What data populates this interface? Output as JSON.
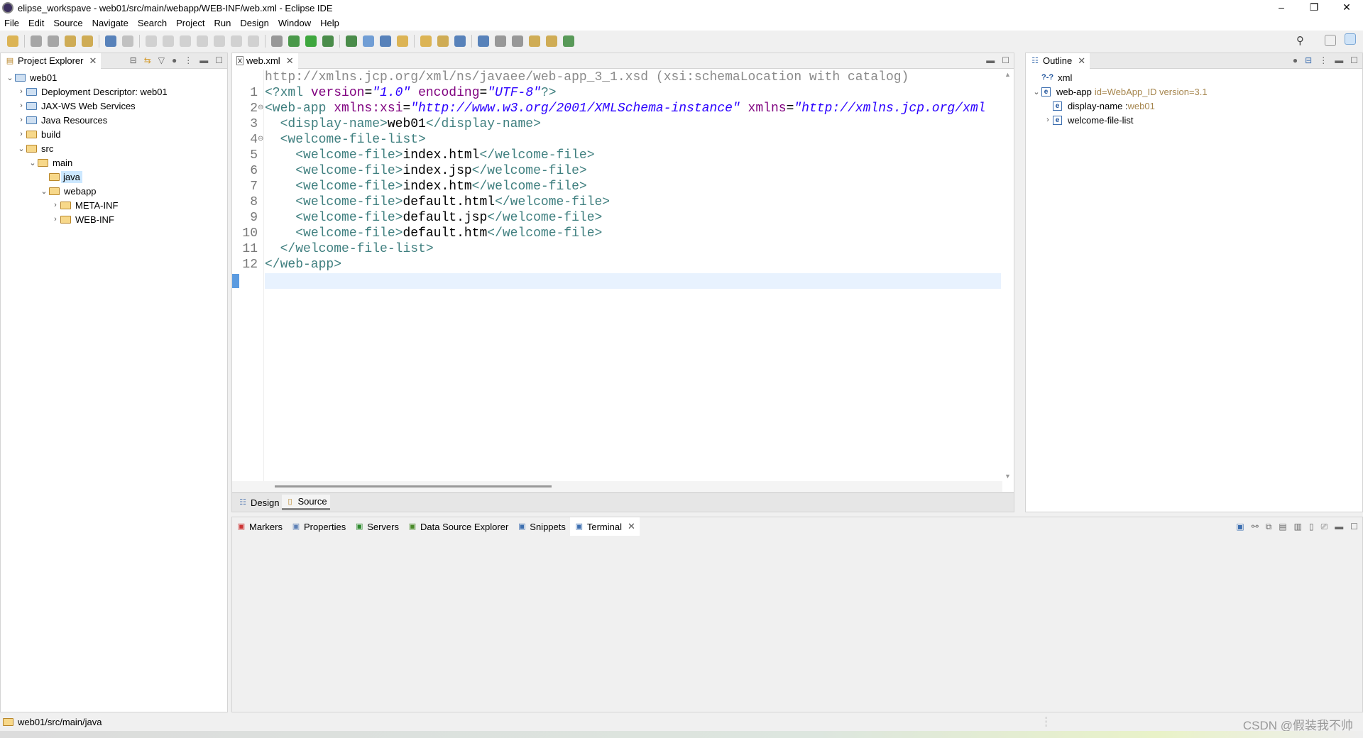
{
  "window": {
    "title": "elipse_workspave - web01/src/main/webapp/WEB-INF/web.xml - Eclipse IDE",
    "controls": [
      "–",
      "❐",
      "✕"
    ]
  },
  "menu": [
    "File",
    "Edit",
    "Source",
    "Navigate",
    "Search",
    "Project",
    "Run",
    "Design",
    "Window",
    "Help"
  ],
  "toolbar_icons": [
    "new-icon",
    "save-icon",
    "save-all-icon",
    "open-type-icon",
    "open-resource-icon",
    "terminal-icon",
    "skip-breakpoints-icon",
    "resume-icon",
    "suspend-icon",
    "terminate-icon",
    "disconnect-icon",
    "step-into-icon",
    "step-over-icon",
    "step-return-icon",
    "use-step-filters-icon",
    "debug-icon",
    "run-icon",
    "coverage-icon",
    "external-tools-icon",
    "new-server-icon",
    "new-class-icon",
    "open-folder-icon",
    "open-task-icon",
    "search-web-icon",
    "globe-icon",
    "publish-icon",
    "next-annotation-icon",
    "prev-annotation-icon",
    "back-icon",
    "forward-icon",
    "pin-icon"
  ],
  "project_explorer": {
    "title": "Project Explorer",
    "tree": [
      {
        "label": "web01",
        "level": 0,
        "expanded": true,
        "icon": "project-icon"
      },
      {
        "label": "Deployment Descriptor: web01",
        "level": 1,
        "expanded": false,
        "icon": "descriptor-icon"
      },
      {
        "label": "JAX-WS Web Services",
        "level": 1,
        "expanded": false,
        "icon": "webservices-icon"
      },
      {
        "label": "Java Resources",
        "level": 1,
        "expanded": false,
        "icon": "java-resources-icon"
      },
      {
        "label": "build",
        "level": 1,
        "expanded": false,
        "icon": "folder-icon"
      },
      {
        "label": "src",
        "level": 1,
        "expanded": true,
        "icon": "folder-icon"
      },
      {
        "label": "main",
        "level": 2,
        "expanded": true,
        "icon": "folder-icon"
      },
      {
        "label": "java",
        "level": 3,
        "expanded": null,
        "icon": "folder-icon",
        "selected": true
      },
      {
        "label": "webapp",
        "level": 3,
        "expanded": true,
        "icon": "folder-icon"
      },
      {
        "label": "META-INF",
        "level": 4,
        "expanded": false,
        "icon": "folder-icon"
      },
      {
        "label": "WEB-INF",
        "level": 4,
        "expanded": false,
        "icon": "folder-icon"
      }
    ]
  },
  "editor": {
    "tab": "web.xml",
    "schema_hint": "http://xmlns.jcp.org/xml/ns/javaee/web-app_3_1.xsd (xsi:schemaLocation with catalog)",
    "lines": [
      [
        [
          "pi",
          "<?xml "
        ],
        [
          "attr",
          "version"
        ],
        [
          "text",
          "="
        ],
        [
          "val",
          "\"1.0\""
        ],
        [
          "text",
          " "
        ],
        [
          "attr",
          "encoding"
        ],
        [
          "text",
          "="
        ],
        [
          "val",
          "\"UTF-8\""
        ],
        [
          "pi",
          "?>"
        ]
      ],
      [
        [
          "tag",
          "<web-app "
        ],
        [
          "attr",
          "xmlns:xsi"
        ],
        [
          "text",
          "="
        ],
        [
          "val",
          "\"http://www.w3.org/2001/XMLSchema-instance\""
        ],
        [
          "text",
          " "
        ],
        [
          "attr",
          "xmlns"
        ],
        [
          "text",
          "="
        ],
        [
          "val",
          "\"http://xmlns.jcp.org/xml"
        ]
      ],
      [
        [
          "text",
          "  "
        ],
        [
          "tag",
          "<display-name>"
        ],
        [
          "text",
          "web01"
        ],
        [
          "tag",
          "</display-name>"
        ]
      ],
      [
        [
          "text",
          "  "
        ],
        [
          "tag",
          "<welcome-file-list>"
        ]
      ],
      [
        [
          "text",
          "    "
        ],
        [
          "tag",
          "<welcome-file>"
        ],
        [
          "text",
          "index.html"
        ],
        [
          "tag",
          "</welcome-file>"
        ]
      ],
      [
        [
          "text",
          "    "
        ],
        [
          "tag",
          "<welcome-file>"
        ],
        [
          "text",
          "index.jsp"
        ],
        [
          "tag",
          "</welcome-file>"
        ]
      ],
      [
        [
          "text",
          "    "
        ],
        [
          "tag",
          "<welcome-file>"
        ],
        [
          "text",
          "index.htm"
        ],
        [
          "tag",
          "</welcome-file>"
        ]
      ],
      [
        [
          "text",
          "    "
        ],
        [
          "tag",
          "<welcome-file>"
        ],
        [
          "text",
          "default.html"
        ],
        [
          "tag",
          "</welcome-file>"
        ]
      ],
      [
        [
          "text",
          "    "
        ],
        [
          "tag",
          "<welcome-file>"
        ],
        [
          "text",
          "default.jsp"
        ],
        [
          "tag",
          "</welcome-file>"
        ]
      ],
      [
        [
          "text",
          "    "
        ],
        [
          "tag",
          "<welcome-file>"
        ],
        [
          "text",
          "default.htm"
        ],
        [
          "tag",
          "</welcome-file>"
        ]
      ],
      [
        [
          "text",
          "  "
        ],
        [
          "tag",
          "</welcome-file-list>"
        ]
      ],
      [
        [
          "tag",
          "</web-app>"
        ]
      ]
    ],
    "folded_lines": [
      2,
      4
    ],
    "current_line": 12,
    "bottom_tabs": [
      "Design",
      "Source"
    ],
    "active_bottom_tab": "Source"
  },
  "outline": {
    "title": "Outline",
    "items": [
      {
        "label": "xml",
        "extra": "",
        "level": 0,
        "chevron": "",
        "icon": "pi-icon"
      },
      {
        "label": "web-app",
        "extra": "id=WebApp_ID version=3.1",
        "level": 0,
        "chevron": "⌄",
        "icon": "element-icon"
      },
      {
        "label": "display-name : ",
        "extra": "web01",
        "level": 1,
        "chevron": "",
        "icon": "element-icon"
      },
      {
        "label": "welcome-file-list",
        "extra": "",
        "level": 1,
        "chevron": "›",
        "icon": "element-icon"
      }
    ]
  },
  "bottom_panel": {
    "tabs": [
      "Markers",
      "Properties",
      "Servers",
      "Data Source Explorer",
      "Snippets",
      "Terminal"
    ],
    "active": "Terminal"
  },
  "status": {
    "path": "web01/src/main/java",
    "watermark": "CSDN @假装我不帅"
  },
  "colors": {
    "tag": "#3f7f7f",
    "attr": "#7f007f",
    "value": "#2a00ff",
    "current_line": "#e8f2fe",
    "selection": "#cce8ff"
  }
}
